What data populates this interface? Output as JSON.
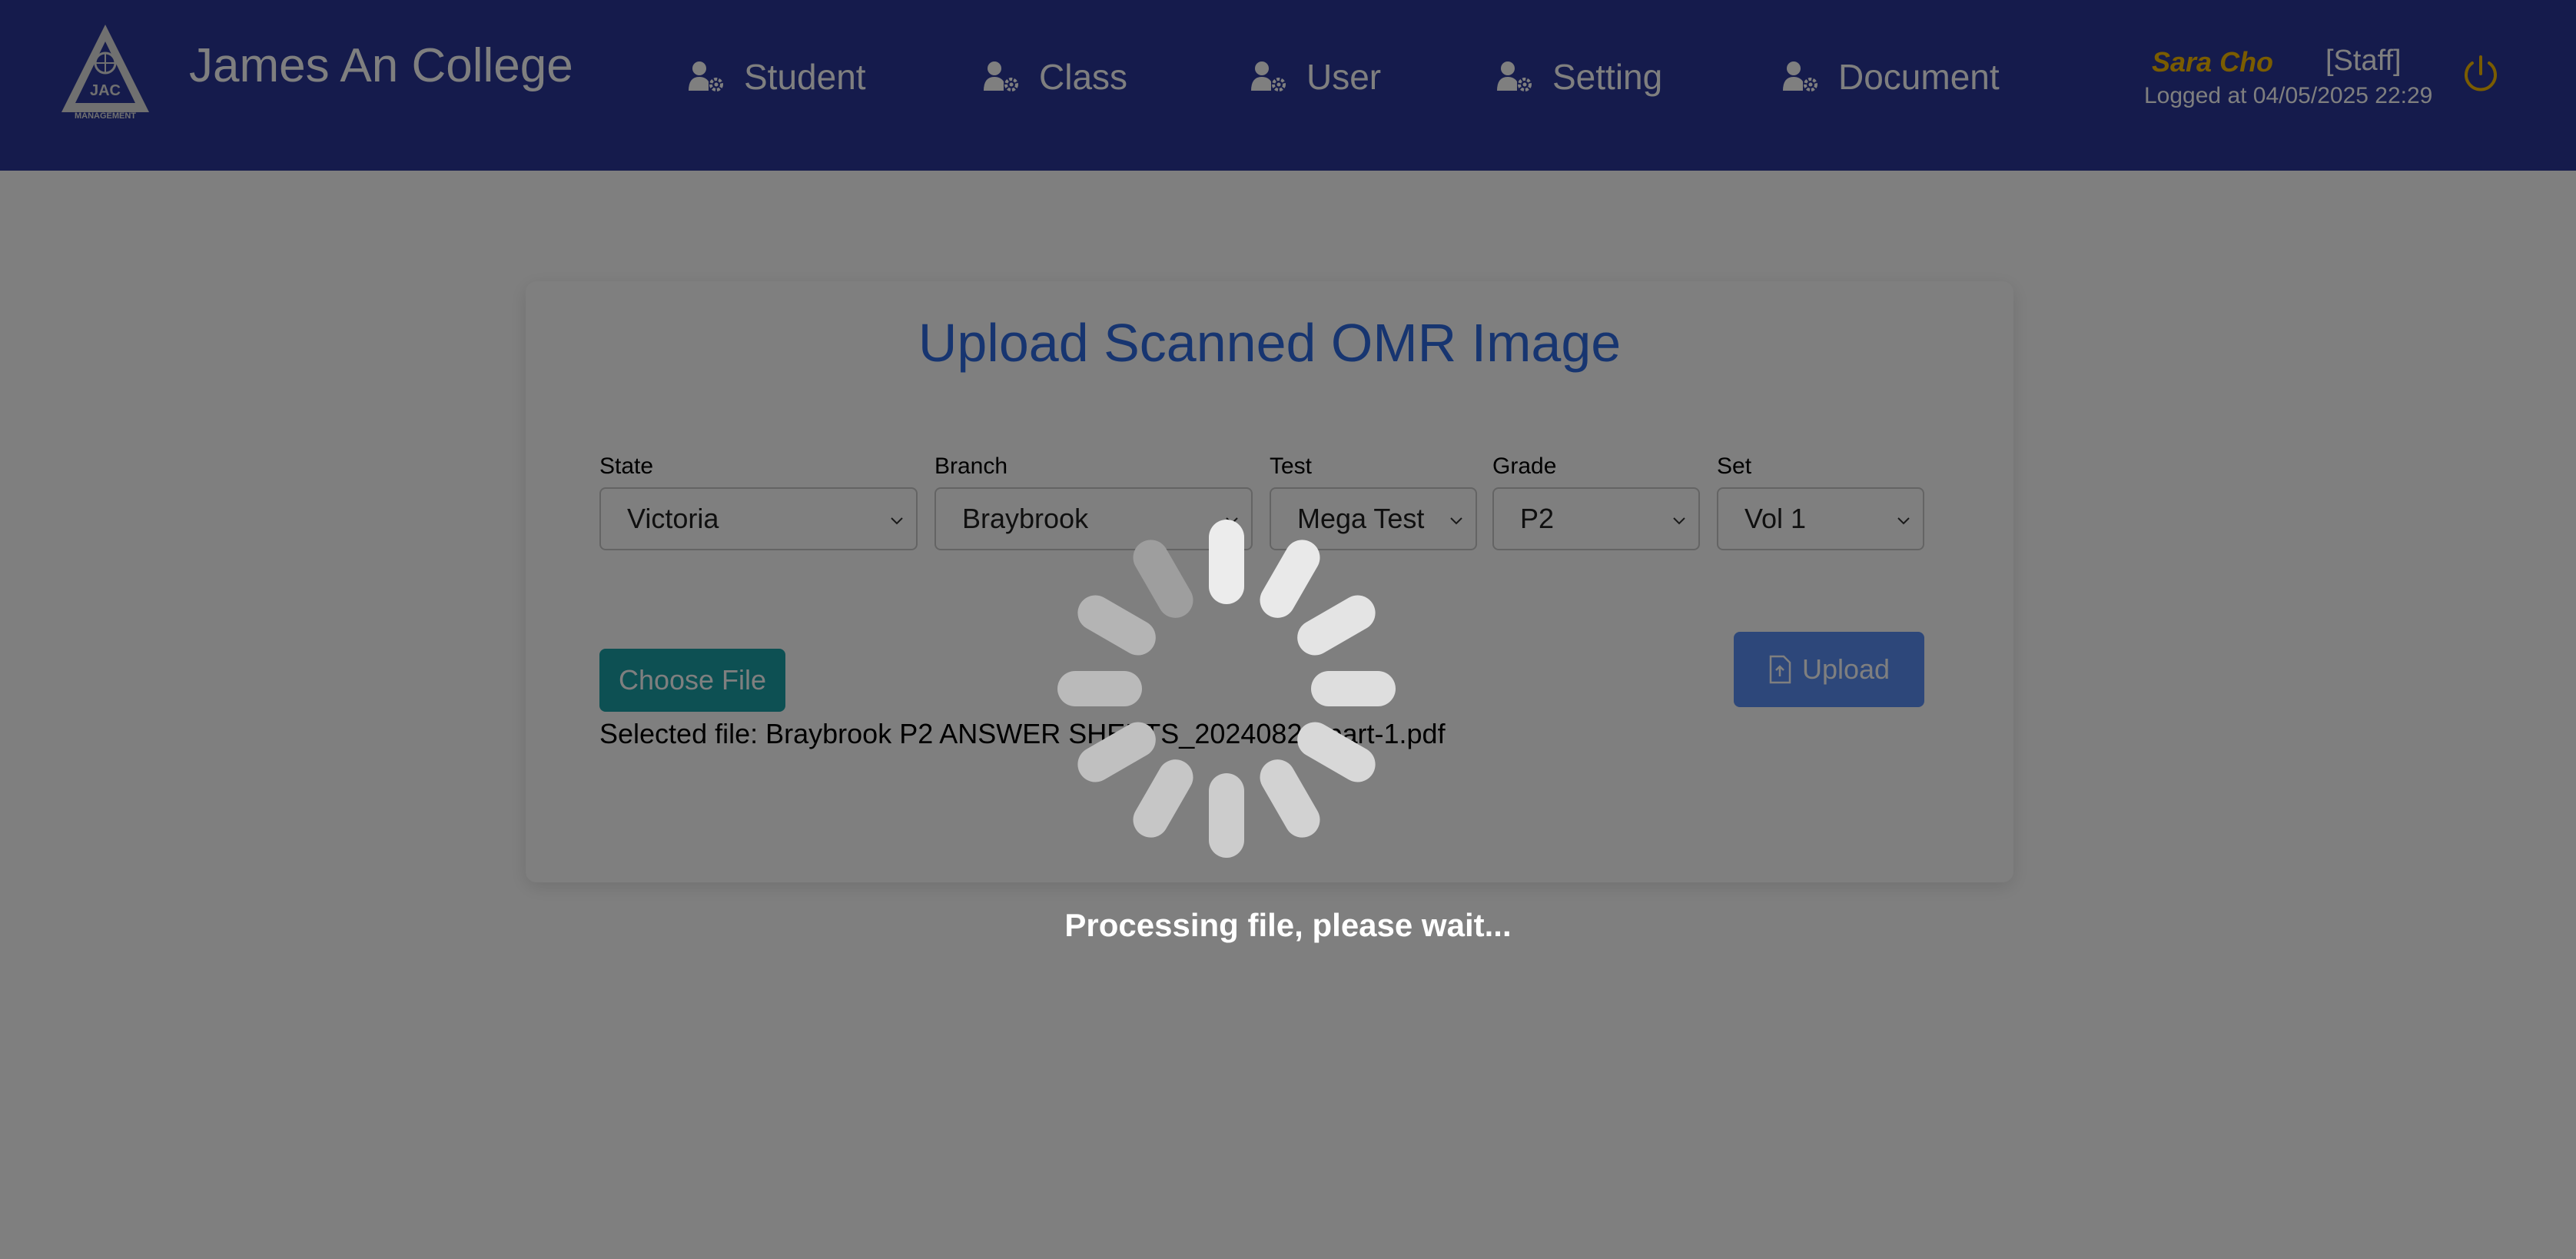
{
  "header": {
    "brand": "James An College",
    "logo": {
      "abbr": "JAC",
      "sub": "MANAGEMENT"
    },
    "nav": [
      {
        "label": "Student",
        "icon": "user-gear-icon"
      },
      {
        "label": "Class",
        "icon": "user-gear-icon"
      },
      {
        "label": "User",
        "icon": "user-gear-icon"
      },
      {
        "label": "Setting",
        "icon": "user-gear-icon"
      },
      {
        "label": "Document",
        "icon": "user-gear-icon"
      }
    ],
    "user": {
      "name": "Sara Cho",
      "role": "[Staff]",
      "logged": "Logged at 04/05/2025 22:29",
      "logout_icon": "power-icon"
    }
  },
  "upload": {
    "title": "Upload Scanned OMR Image",
    "fields": [
      {
        "label": "State",
        "value": "Victoria"
      },
      {
        "label": "Branch",
        "value": "Braybrook"
      },
      {
        "label": "Test",
        "value": "Mega Test"
      },
      {
        "label": "Grade",
        "value": "P2"
      },
      {
        "label": "Set",
        "value": "Vol 1"
      }
    ],
    "choose_label": "Choose File",
    "selected_file": "Selected file: Braybrook P2 ANSWER SHEETS_20240824-part-1.pdf",
    "upload_label": "Upload",
    "upload_icon": "file-upload-icon"
  },
  "overlay": {
    "message": "Processing file, please wait...",
    "spinner_icon": "loading-spinner-icon"
  },
  "colors": {
    "header_bg": "#2a3699",
    "title": "#2f6be0",
    "choose_button": "#1ba0a6",
    "upload_button": "#5a8ff4",
    "user_name": "#f5b800"
  }
}
